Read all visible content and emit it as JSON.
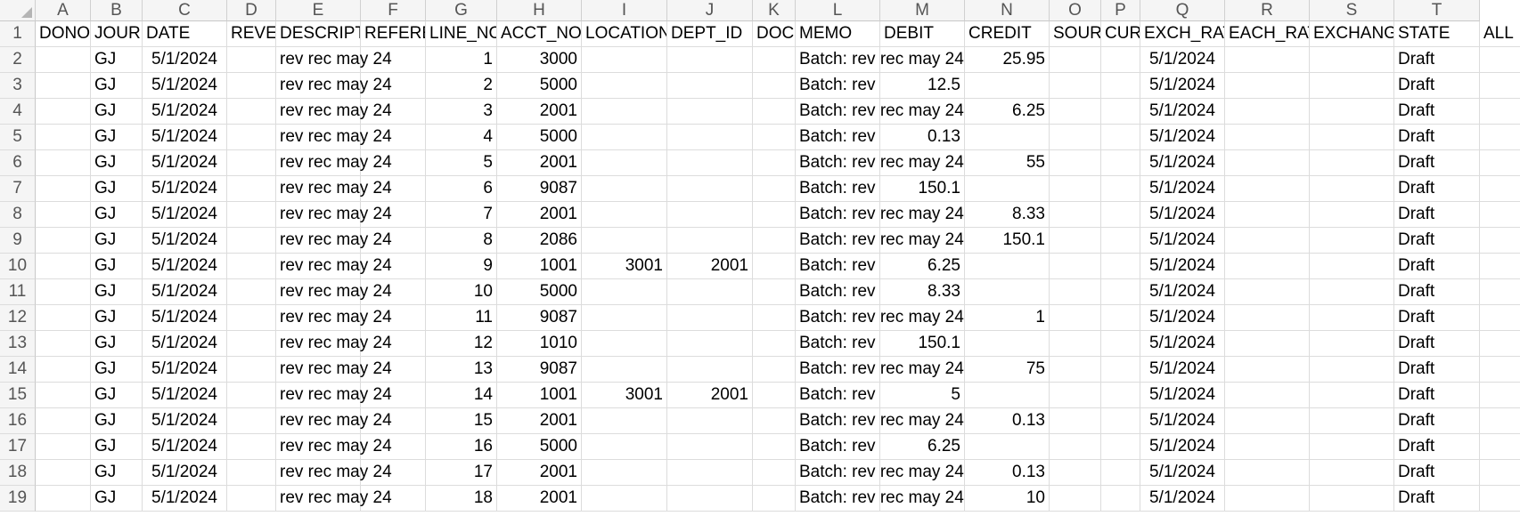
{
  "columns": [
    "A",
    "B",
    "C",
    "D",
    "E",
    "F",
    "G",
    "H",
    "I",
    "J",
    "K",
    "L",
    "M",
    "N",
    "O",
    "P",
    "Q",
    "R",
    "S",
    "T"
  ],
  "header_row": [
    "DONO",
    "JOURN",
    "DATE",
    "REVEI",
    "DESCRIPTI",
    "REFEREI",
    "LINE_NO",
    "ACCT_NO",
    "LOCATION",
    "DEPT_ID",
    "DOCI",
    "MEMO",
    "DEBIT",
    "CREDIT",
    "SOURC",
    "CUR",
    "EXCH_RAT",
    "EACH_RAT",
    "EXCHANG",
    "STATE",
    "ALL"
  ],
  "rows": [
    {
      "n": "2",
      "B": "GJ",
      "C": "5/1/2024",
      "E": "rev rec may 24",
      "G": "1",
      "H": "3000",
      "I": "",
      "J": "",
      "L": "Batch: rev rec may 24",
      "M": "",
      "N": "25.95",
      "Q": "5/1/2024",
      "T": "Draft"
    },
    {
      "n": "3",
      "B": "GJ",
      "C": "5/1/2024",
      "E": "rev rec may 24",
      "G": "2",
      "H": "5000",
      "I": "",
      "J": "",
      "L": "Batch: rev",
      "M": "12.5",
      "N": "",
      "Q": "5/1/2024",
      "T": "Draft"
    },
    {
      "n": "4",
      "B": "GJ",
      "C": "5/1/2024",
      "E": "rev rec may 24",
      "G": "3",
      "H": "2001",
      "I": "",
      "J": "",
      "L": "Batch: rev rec may 24",
      "M": "",
      "N": "6.25",
      "Q": "5/1/2024",
      "T": "Draft"
    },
    {
      "n": "5",
      "B": "GJ",
      "C": "5/1/2024",
      "E": "rev rec may 24",
      "G": "4",
      "H": "5000",
      "I": "",
      "J": "",
      "L": "Batch: rev",
      "M": "0.13",
      "N": "",
      "Q": "5/1/2024",
      "T": "Draft"
    },
    {
      "n": "6",
      "B": "GJ",
      "C": "5/1/2024",
      "E": "rev rec may 24",
      "G": "5",
      "H": "2001",
      "I": "",
      "J": "",
      "L": "Batch: rev rec may 24",
      "M": "",
      "N": "55",
      "Q": "5/1/2024",
      "T": "Draft"
    },
    {
      "n": "7",
      "B": "GJ",
      "C": "5/1/2024",
      "E": "rev rec may 24",
      "G": "6",
      "H": "9087",
      "I": "",
      "J": "",
      "L": "Batch: rev",
      "M": "150.1",
      "N": "",
      "Q": "5/1/2024",
      "T": "Draft"
    },
    {
      "n": "8",
      "B": "GJ",
      "C": "5/1/2024",
      "E": "rev rec may 24",
      "G": "7",
      "H": "2001",
      "I": "",
      "J": "",
      "L": "Batch: rev rec may 24",
      "M": "",
      "N": "8.33",
      "Q": "5/1/2024",
      "T": "Draft"
    },
    {
      "n": "9",
      "B": "GJ",
      "C": "5/1/2024",
      "E": "rev rec may 24",
      "G": "8",
      "H": "2086",
      "I": "",
      "J": "",
      "L": "Batch: rev rec may 24",
      "M": "",
      "N": "150.1",
      "Q": "5/1/2024",
      "T": "Draft"
    },
    {
      "n": "10",
      "B": "GJ",
      "C": "5/1/2024",
      "E": "rev rec may 24",
      "G": "9",
      "H": "1001",
      "I": "3001",
      "J": "2001",
      "L": "Batch: rev",
      "M": "6.25",
      "N": "",
      "Q": "5/1/2024",
      "T": "Draft"
    },
    {
      "n": "11",
      "B": "GJ",
      "C": "5/1/2024",
      "E": "rev rec may 24",
      "G": "10",
      "H": "5000",
      "I": "",
      "J": "",
      "L": "Batch: rev",
      "M": "8.33",
      "N": "",
      "Q": "5/1/2024",
      "T": "Draft"
    },
    {
      "n": "12",
      "B": "GJ",
      "C": "5/1/2024",
      "E": "rev rec may 24",
      "G": "11",
      "H": "9087",
      "I": "",
      "J": "",
      "L": "Batch: rev rec may 24",
      "M": "",
      "N": "1",
      "Q": "5/1/2024",
      "T": "Draft"
    },
    {
      "n": "13",
      "B": "GJ",
      "C": "5/1/2024",
      "E": "rev rec may 24",
      "G": "12",
      "H": "1010",
      "I": "",
      "J": "",
      "L": "Batch: rev",
      "M": "150.1",
      "N": "",
      "Q": "5/1/2024",
      "T": "Draft"
    },
    {
      "n": "14",
      "B": "GJ",
      "C": "5/1/2024",
      "E": "rev rec may 24",
      "G": "13",
      "H": "9087",
      "I": "",
      "J": "",
      "L": "Batch: rev rec may 24",
      "M": "",
      "N": "75",
      "Q": "5/1/2024",
      "T": "Draft"
    },
    {
      "n": "15",
      "B": "GJ",
      "C": "5/1/2024",
      "E": "rev rec may 24",
      "G": "14",
      "H": "1001",
      "I": "3001",
      "J": "2001",
      "L": "Batch: rev",
      "M": "5",
      "N": "",
      "Q": "5/1/2024",
      "T": "Draft"
    },
    {
      "n": "16",
      "B": "GJ",
      "C": "5/1/2024",
      "E": "rev rec may 24",
      "G": "15",
      "H": "2001",
      "I": "",
      "J": "",
      "L": "Batch: rev rec may 24",
      "M": "",
      "N": "0.13",
      "Q": "5/1/2024",
      "T": "Draft"
    },
    {
      "n": "17",
      "B": "GJ",
      "C": "5/1/2024",
      "E": "rev rec may 24",
      "G": "16",
      "H": "5000",
      "I": "",
      "J": "",
      "L": "Batch: rev",
      "M": "6.25",
      "N": "",
      "Q": "5/1/2024",
      "T": "Draft"
    },
    {
      "n": "18",
      "B": "GJ",
      "C": "5/1/2024",
      "E": "rev rec may 24",
      "G": "17",
      "H": "2001",
      "I": "",
      "J": "",
      "L": "Batch: rev rec may 24",
      "M": "",
      "N": "0.13",
      "Q": "5/1/2024",
      "T": "Draft"
    },
    {
      "n": "19",
      "B": "GJ",
      "C": "5/1/2024",
      "E": "rev rec may 24",
      "G": "18",
      "H": "2001",
      "I": "",
      "J": "",
      "L": "Batch: rev rec may 24",
      "M": "",
      "N": "10",
      "Q": "5/1/2024",
      "T": "Draft"
    }
  ]
}
